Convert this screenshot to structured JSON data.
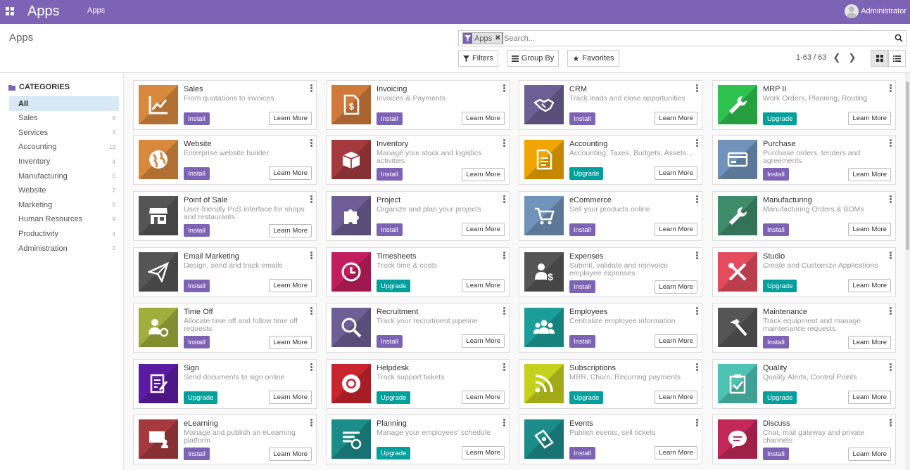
{
  "topbar": {
    "app_title": "Apps",
    "nav_apps": "Apps",
    "user_name": "Administrator"
  },
  "control": {
    "breadcrumb": "Apps",
    "facet_value": "Apps",
    "search_placeholder": "Search...",
    "filters_label": "Filters",
    "groupby_label": "Group By",
    "favorites_label": "Favorites",
    "pager_text": "1-63 / 63"
  },
  "sidebar": {
    "title": "CATEGORIES",
    "items": [
      {
        "label": "All",
        "count": ""
      },
      {
        "label": "Sales",
        "count": "8"
      },
      {
        "label": "Services",
        "count": "3"
      },
      {
        "label": "Accounting",
        "count": "13"
      },
      {
        "label": "Inventory",
        "count": "4"
      },
      {
        "label": "Manufacturing",
        "count": "5"
      },
      {
        "label": "Website",
        "count": "7"
      },
      {
        "label": "Marketing",
        "count": "5"
      },
      {
        "label": "Human Resources",
        "count": "9"
      },
      {
        "label": "Productivity",
        "count": "4"
      },
      {
        "label": "Administration",
        "count": "2"
      }
    ]
  },
  "colors": {
    "brand": "#7c63b5",
    "upgrade": "#00a09d"
  },
  "buttons": {
    "install": "Install",
    "upgrade": "Upgrade",
    "learn_more": "Learn More"
  },
  "apps": [
    {
      "name": "Sales",
      "desc": "From quotations to invoices",
      "action": "install",
      "bg": "#d9893e",
      "icon": "chart-trend-icon"
    },
    {
      "name": "Invoicing",
      "desc": "Invoices & Payments",
      "action": "install",
      "bg": "#cf7a3a",
      "icon": "invoice-dollar-icon"
    },
    {
      "name": "CRM",
      "desc": "Track leads and close opportunities",
      "action": "install",
      "bg": "#6f5e95",
      "icon": "handshake-icon"
    },
    {
      "name": "MRP II",
      "desc": "Work Orders, Planning, Routing",
      "action": "upgrade",
      "bg": "#2ec24f",
      "icon": "wrench-icon"
    },
    {
      "name": "Website",
      "desc": "Enterprise website builder",
      "action": "install",
      "bg": "#d9893e",
      "icon": "globe-icon"
    },
    {
      "name": "Inventory",
      "desc": "Manage your stock and logistics activities",
      "action": "install",
      "bg": "#a53a3e",
      "icon": "box-icon"
    },
    {
      "name": "Accounting",
      "desc": "Accounting, Taxes, Budgets, Assets...",
      "action": "upgrade",
      "bg": "#f0a500",
      "icon": "document-icon"
    },
    {
      "name": "Purchase",
      "desc": "Purchase orders, tenders and agreements",
      "action": "install",
      "bg": "#6f93bb",
      "icon": "credit-card-icon"
    },
    {
      "name": "Point of Sale",
      "desc": "User-friendly PoS interface for shops and restaurants",
      "action": "install",
      "bg": "#555555",
      "icon": "shop-icon"
    },
    {
      "name": "Project",
      "desc": "Organize and plan your projects",
      "action": "install",
      "bg": "#6f5e95",
      "icon": "puzzle-icon"
    },
    {
      "name": "eCommerce",
      "desc": "Sell your products online",
      "action": "install",
      "bg": "#6f93bb",
      "icon": "cart-icon"
    },
    {
      "name": "Manufacturing",
      "desc": "Manufacturing Orders & BOMs",
      "action": "install",
      "bg": "#3f8c6a",
      "icon": "wrench-icon"
    },
    {
      "name": "Email Marketing",
      "desc": "Design, send and track emails",
      "action": "install",
      "bg": "#555555",
      "icon": "paper-plane-icon"
    },
    {
      "name": "Timesheets",
      "desc": "Track time & costs",
      "action": "upgrade",
      "bg": "#c21d5f",
      "icon": "clock-icon"
    },
    {
      "name": "Expenses",
      "desc": "Submit, validate and reinvoice employee expenses",
      "action": "install",
      "bg": "#555555",
      "icon": "user-dollar-icon"
    },
    {
      "name": "Studio",
      "desc": "Create and Customize Applications",
      "action": "upgrade",
      "bg": "#e44b5e",
      "icon": "tools-icon"
    },
    {
      "name": "Time Off",
      "desc": "Allocate time off and follow time off requests",
      "action": "install",
      "bg": "#9fae3c",
      "icon": "user-gear-icon"
    },
    {
      "name": "Recruitment",
      "desc": "Track your recruitment pipeline",
      "action": "install",
      "bg": "#6f5e95",
      "icon": "magnifier-icon"
    },
    {
      "name": "Employees",
      "desc": "Centralize employee information",
      "action": "install",
      "bg": "#1b9e9a",
      "icon": "users-icon"
    },
    {
      "name": "Maintenance",
      "desc": "Track equipment and manage maintenance requests",
      "action": "install",
      "bg": "#555555",
      "icon": "hammer-icon"
    },
    {
      "name": "Sign",
      "desc": "Send documents to sign online",
      "action": "upgrade",
      "bg": "#5c1ba3",
      "icon": "sign-document-icon"
    },
    {
      "name": "Helpdesk",
      "desc": "Track support tickets",
      "action": "upgrade",
      "bg": "#c9252e",
      "icon": "lifebuoy-icon"
    },
    {
      "name": "Subscriptions",
      "desc": "MRR, Churn, Recurring payments",
      "action": "upgrade",
      "bg": "#c5d11c",
      "icon": "rss-icon"
    },
    {
      "name": "Quality",
      "desc": "Quality Alerts, Control Points",
      "action": "upgrade",
      "bg": "#4ec3b4",
      "icon": "clipboard-check-icon"
    },
    {
      "name": "eLearning",
      "desc": "Manage and publish an eLearning platform",
      "action": "install",
      "bg": "#a53a3e",
      "icon": "presentation-icon"
    },
    {
      "name": "Planning",
      "desc": "Manage your employees' schedule",
      "action": "upgrade",
      "bg": "#1b8c8a",
      "icon": "planning-icon"
    },
    {
      "name": "Events",
      "desc": "Publish events, sell tickets",
      "action": "install",
      "bg": "#1b8c8a",
      "icon": "ticket-icon"
    },
    {
      "name": "Discuss",
      "desc": "Chat, mail gateway and private channels",
      "action": "install",
      "bg": "#c2285a",
      "icon": "chat-bubble-icon"
    }
  ]
}
